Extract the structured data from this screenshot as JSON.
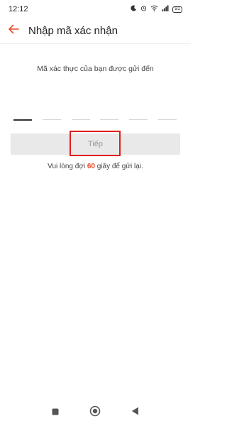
{
  "status_bar": {
    "time": "12:12",
    "battery": "91",
    "icons": [
      "moon-icon",
      "alarm-icon",
      "wifi-icon",
      "signal-icon",
      "battery-icon"
    ]
  },
  "header": {
    "title": "Nhập mã xác nhận",
    "back_icon": "arrow-left-icon",
    "accent_color": "#e8492a"
  },
  "main": {
    "instruction": "Mã xác thực của bạn được gửi đến",
    "otp_slots": 6,
    "next_label": "Tiếp",
    "resend_prefix": "Vui lòng đợi",
    "resend_seconds": "60",
    "resend_suffix": "giây để gửi lại."
  },
  "nav_bar": {
    "icons": [
      "recent-apps-icon",
      "home-icon",
      "back-icon"
    ]
  }
}
